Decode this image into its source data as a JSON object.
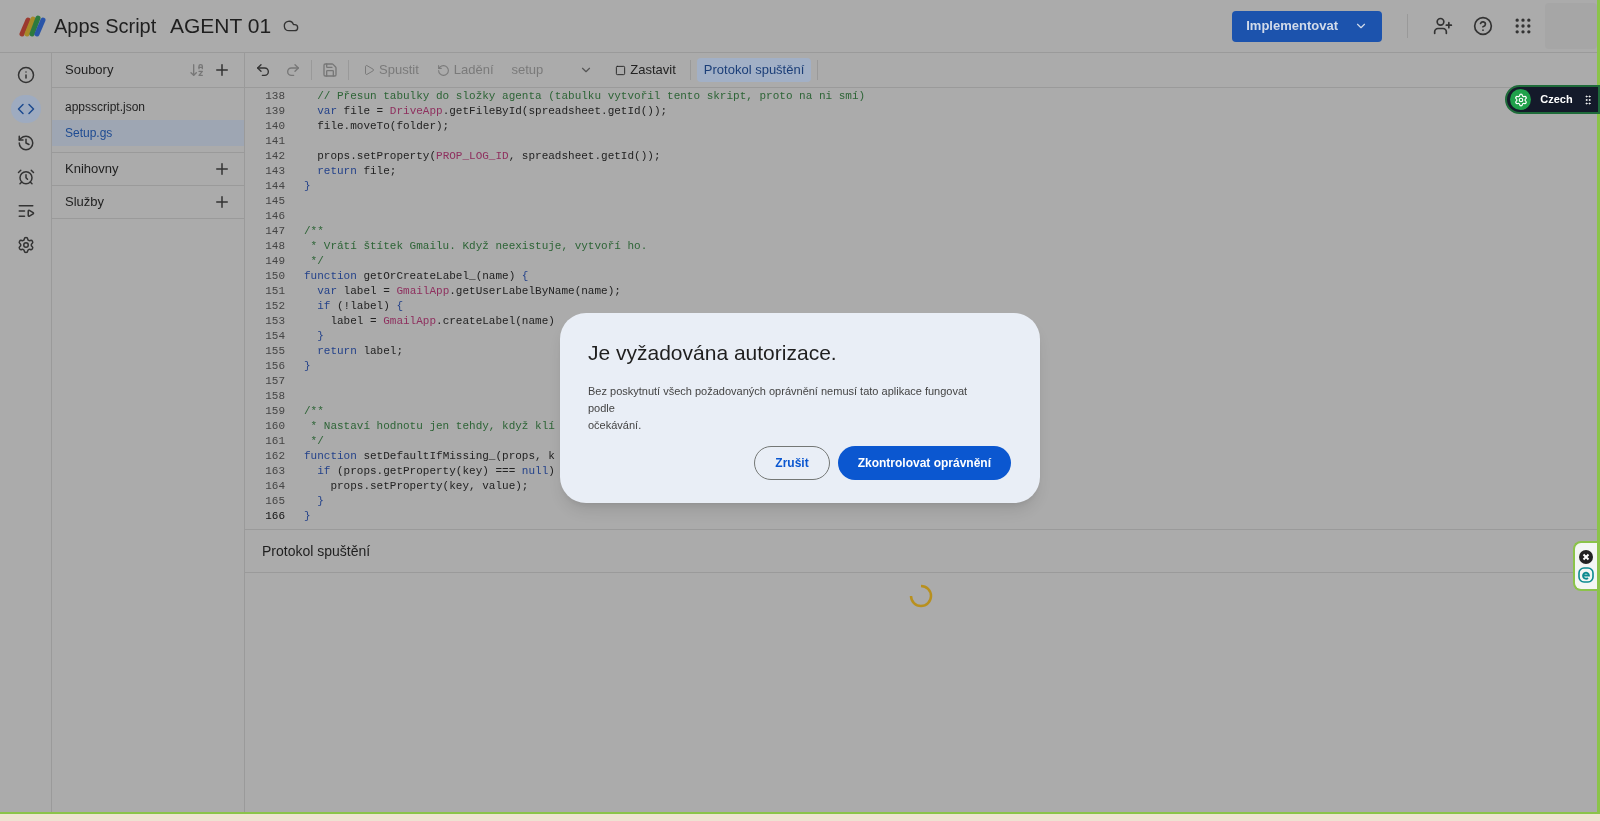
{
  "header": {
    "app_name": "Apps Script",
    "project_name": "AGENT 01",
    "deploy_button": "Implementovat"
  },
  "rail": [
    {
      "kind": "info",
      "selected": false
    },
    {
      "kind": "code",
      "selected": true
    },
    {
      "kind": "history",
      "selected": false
    },
    {
      "kind": "triggers",
      "selected": false
    },
    {
      "kind": "executions",
      "selected": false
    },
    {
      "kind": "settings",
      "selected": false
    }
  ],
  "files_panel": {
    "title": "Soubory",
    "files": [
      {
        "name": "appsscript.json",
        "selected": false
      },
      {
        "name": "Setup.gs",
        "selected": true
      }
    ],
    "sections": [
      {
        "title": "Knihovny"
      },
      {
        "title": "Služby"
      }
    ]
  },
  "toolbar": {
    "run": {
      "label": "Spustit",
      "disabled": true
    },
    "debug": {
      "label": "Ladění",
      "disabled": true
    },
    "function_select": "setup",
    "stop": "Zastavit",
    "log_button": {
      "label": "Protokol spuštění",
      "selected": true
    }
  },
  "editor": {
    "lines": [
      {
        "number": "138",
        "tokens": [
          {
            "kind": "cm",
            "text": "  // Přesun tabulky do složky agenta (tabulku vytvořil tento skript, proto na ni smí)"
          }
        ]
      },
      {
        "number": "139",
        "tokens": [
          {
            "kind": "kw",
            "text": "  var"
          },
          {
            "kind": "pl",
            "text": " file = "
          },
          {
            "kind": "cls",
            "text": "DriveApp"
          },
          {
            "kind": "pl",
            "text": ".getFileById(spreadsheet.getId());"
          }
        ]
      },
      {
        "number": "140",
        "tokens": [
          {
            "kind": "pl",
            "text": "  file.moveTo(folder);"
          }
        ]
      },
      {
        "number": "141"
      },
      {
        "number": "142",
        "tokens": [
          {
            "kind": "pl",
            "text": "  props.setProperty("
          },
          {
            "kind": "cls",
            "text": "PROP_LOG_ID"
          },
          {
            "kind": "pl",
            "text": ", spreadsheet.getId());"
          }
        ]
      },
      {
        "number": "143",
        "tokens": [
          {
            "kind": "kw",
            "text": "  return"
          },
          {
            "kind": "pl",
            "text": " file;"
          }
        ]
      },
      {
        "number": "144",
        "tokens": [
          {
            "kind": "br",
            "text": "}"
          }
        ]
      },
      {
        "number": "145"
      },
      {
        "number": "146"
      },
      {
        "number": "147",
        "tokens": [
          {
            "kind": "cm",
            "text": "/**"
          }
        ]
      },
      {
        "number": "148",
        "tokens": [
          {
            "kind": "cm",
            "text": " * Vrátí štítek Gmailu. Když neexistuje, vytvoří ho."
          }
        ]
      },
      {
        "number": "149",
        "tokens": [
          {
            "kind": "cm",
            "text": " */"
          }
        ]
      },
      {
        "number": "150",
        "tokens": [
          {
            "kind": "kw",
            "text": "function"
          },
          {
            "kind": "pl",
            "text": " getOrCreateLabel_(name) "
          },
          {
            "kind": "br",
            "text": "{"
          }
        ]
      },
      {
        "number": "151",
        "tokens": [
          {
            "kind": "kw",
            "text": "  var"
          },
          {
            "kind": "pl",
            "text": " label = "
          },
          {
            "kind": "cls",
            "text": "GmailApp"
          },
          {
            "kind": "pl",
            "text": ".getUserLabelByName(name);"
          }
        ]
      },
      {
        "number": "152",
        "tokens": [
          {
            "kind": "kw",
            "text": "  if"
          },
          {
            "kind": "pl",
            "text": " (!label) "
          },
          {
            "kind": "br",
            "text": "{"
          }
        ]
      },
      {
        "number": "153",
        "tokens": [
          {
            "kind": "pl",
            "text": "    label = "
          },
          {
            "kind": "cls",
            "text": "GmailApp"
          },
          {
            "kind": "pl",
            "text": ".createLabel(name)"
          }
        ]
      },
      {
        "number": "154",
        "tokens": [
          {
            "kind": "br",
            "text": "  }"
          }
        ]
      },
      {
        "number": "155",
        "tokens": [
          {
            "kind": "kw",
            "text": "  return"
          },
          {
            "kind": "pl",
            "text": " label;"
          }
        ]
      },
      {
        "number": "156",
        "tokens": [
          {
            "kind": "br",
            "text": "}"
          }
        ]
      },
      {
        "number": "157"
      },
      {
        "number": "158"
      },
      {
        "number": "159",
        "tokens": [
          {
            "kind": "cm",
            "text": "/**"
          }
        ]
      },
      {
        "number": "160",
        "tokens": [
          {
            "kind": "cm",
            "text": " * Nastaví hodnotu jen tehdy, když klí"
          }
        ]
      },
      {
        "number": "161",
        "tokens": [
          {
            "kind": "cm",
            "text": " */"
          }
        ]
      },
      {
        "number": "162",
        "tokens": [
          {
            "kind": "kw",
            "text": "function"
          },
          {
            "kind": "pl",
            "text": " setDefaultIfMissing_(props, k"
          }
        ]
      },
      {
        "number": "163",
        "tokens": [
          {
            "kind": "kw",
            "text": "  if"
          },
          {
            "kind": "pl",
            "text": " (props.getProperty(key) === "
          },
          {
            "kind": "kw",
            "text": "null"
          },
          {
            "kind": "pl",
            "text": ")"
          }
        ]
      },
      {
        "number": "164",
        "tokens": [
          {
            "kind": "pl",
            "text": "    props.setProperty(key, value);"
          }
        ]
      },
      {
        "number": "165",
        "tokens": [
          {
            "kind": "br",
            "text": "  }"
          }
        ]
      },
      {
        "number": "166",
        "tokens": [
          {
            "kind": "br",
            "text": "}"
          }
        ]
      }
    ]
  },
  "log_panel": {
    "title": "Protokol spuštění"
  },
  "dialog": {
    "title": "Je vyžadována autorizace.",
    "body_lines": [
      "Bez poskytnutí všech požadovaných oprávnění nemusí tato aplikace fungovat",
      "podle",
      "očekávání."
    ],
    "cancel_button": "Zrušit",
    "confirm_button": "Zkontrolovat oprávnění"
  },
  "translator_widget": {
    "label": "Czech"
  }
}
